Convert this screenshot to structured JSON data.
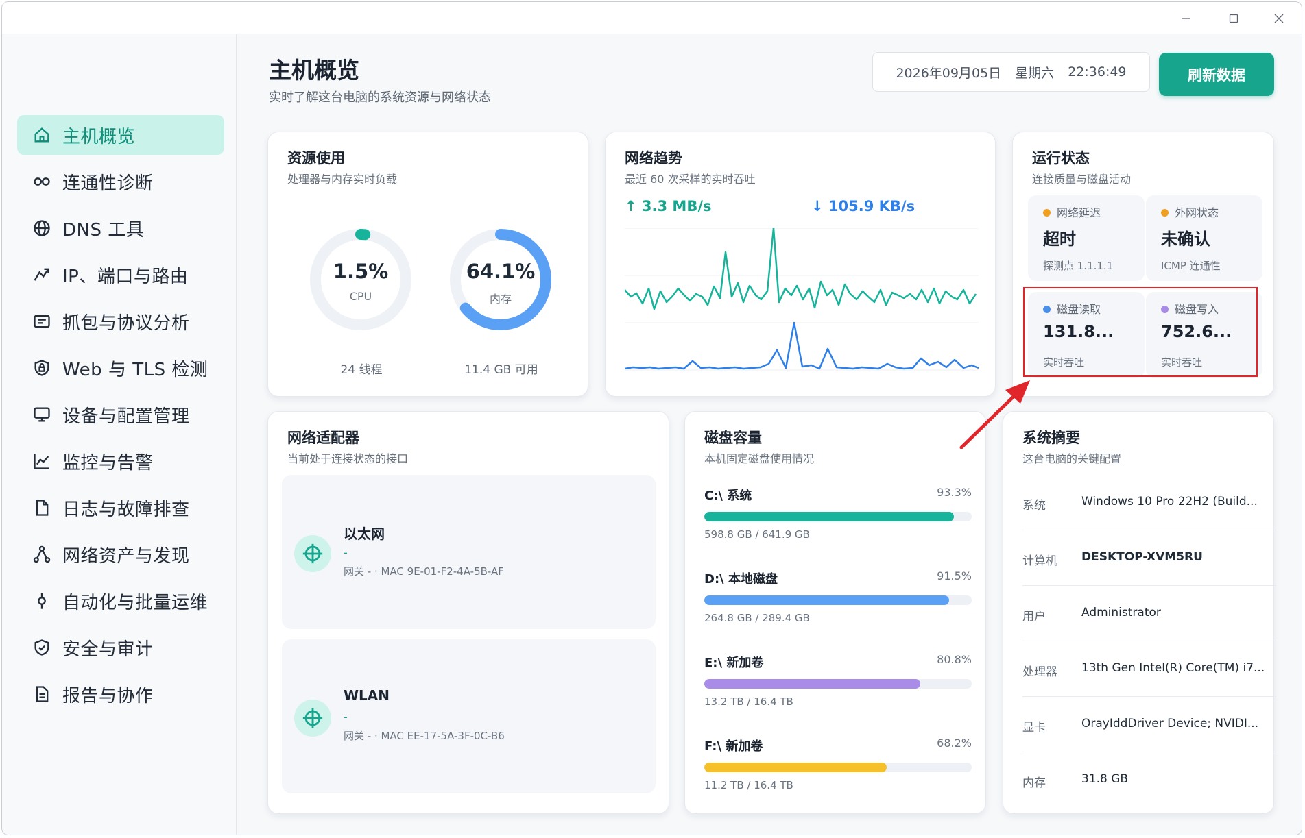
{
  "window": {
    "controls": {
      "minimize": "minimize-icon",
      "maximize": "maximize-icon",
      "close": "close-icon"
    }
  },
  "sidebar": {
    "items": [
      {
        "label": "主机概览",
        "icon": "home-icon",
        "active": true
      },
      {
        "label": "连通性诊断",
        "icon": "link-icon"
      },
      {
        "label": "DNS 工具",
        "icon": "globe-icon"
      },
      {
        "label": "IP、端口与路由",
        "icon": "route-icon"
      },
      {
        "label": "抓包与协议分析",
        "icon": "packet-icon"
      },
      {
        "label": "Web 与 TLS 检测",
        "icon": "shield-lock-icon"
      },
      {
        "label": "设备与配置管理",
        "icon": "monitor-icon"
      },
      {
        "label": "监控与告警",
        "icon": "chart-icon"
      },
      {
        "label": "日志与故障排查",
        "icon": "file-icon"
      },
      {
        "label": "网络资产与发现",
        "icon": "nodes-icon"
      },
      {
        "label": "自动化与批量运维",
        "icon": "automation-icon"
      },
      {
        "label": "安全与审计",
        "icon": "shield-check-icon"
      },
      {
        "label": "报告与协作",
        "icon": "report-icon"
      }
    ]
  },
  "header": {
    "title": "主机概览",
    "subtitle": "实时了解这台电脑的系统资源与网络状态",
    "date": "2026年09月05日",
    "weekday": "星期六",
    "time": "22:36:49",
    "refresh_label": "刷新数据"
  },
  "resource": {
    "title": "资源使用",
    "subtitle": "处理器与内存实时负载",
    "cpu": {
      "value": "1.5%",
      "label": "CPU",
      "foot": "24 线程",
      "fraction": 0.015,
      "color": "#17b39b"
    },
    "mem": {
      "value": "64.1%",
      "label": "内存",
      "foot": "11.4 GB 可用",
      "fraction": 0.641,
      "color": "#5aa0f5"
    }
  },
  "network_trend": {
    "title": "网络趋势",
    "subtitle": "最近 60 次采样的实时吞吐",
    "up": "↑ 3.3 MB/s",
    "down": "↓ 105.9 KB/s",
    "up_color": "#17b39b",
    "down_color": "#2f7fe8"
  },
  "status": {
    "title": "运行状态",
    "subtitle": "连接质量与磁盘活动",
    "tiles": [
      {
        "label": "网络延迟",
        "value": "超时",
        "foot": "探测点 1.1.1.1",
        "dot": "#f0a020"
      },
      {
        "label": "外网状态",
        "value": "未确认",
        "foot": "ICMP 连通性",
        "dot": "#f0a020"
      },
      {
        "label": "磁盘读取",
        "value": "131.8...",
        "foot": "实时吞吐",
        "dot": "#4a90e8"
      },
      {
        "label": "磁盘写入",
        "value": "752.6...",
        "foot": "实时吞吐",
        "dot": "#a98be8"
      }
    ]
  },
  "adapters": {
    "title": "网络适配器",
    "subtitle": "当前处于连接状态的接口",
    "items": [
      {
        "name": "以太网",
        "ip": "-",
        "meta": "网关 -  ·  MAC 9E-01-F2-4A-5B-AF"
      },
      {
        "name": "WLAN",
        "ip": "-",
        "meta": "网关 -  ·  MAC EE-17-5A-3F-0C-B6"
      }
    ]
  },
  "disks": {
    "title": "磁盘容量",
    "subtitle": "本机固定磁盘使用情况",
    "items": [
      {
        "name": "C:\\ 系统",
        "pct": "93.3%",
        "size": "598.8 GB / 641.9 GB",
        "fraction": 0.933,
        "color": "#17b39b"
      },
      {
        "name": "D:\\ 本地磁盘",
        "pct": "91.5%",
        "size": "264.8 GB / 289.4 GB",
        "fraction": 0.915,
        "color": "#5aa0f5"
      },
      {
        "name": "E:\\ 新加卷",
        "pct": "80.8%",
        "size": "13.2 TB / 16.4 TB",
        "fraction": 0.808,
        "color": "#a98be8"
      },
      {
        "name": "F:\\ 新加卷",
        "pct": "68.2%",
        "size": "11.2 TB / 16.4 TB",
        "fraction": 0.682,
        "color": "#f6c02b"
      }
    ]
  },
  "summary": {
    "title": "系统摘要",
    "subtitle": "这台电脑的关键配置",
    "rows": [
      {
        "key": "系统",
        "value": "Windows 10 Pro 22H2 (Build..."
      },
      {
        "key": "计算机",
        "value": "DESKTOP-XVM5RU"
      },
      {
        "key": "用户",
        "value": "Administrator"
      },
      {
        "key": "处理器",
        "value": "13th Gen Intel(R) Core(TM) i7..."
      },
      {
        "key": "显卡",
        "value": "OrayIddDriver Device; NVIDI..."
      },
      {
        "key": "内存",
        "value": "31.8 GB"
      }
    ]
  },
  "annotation": {
    "color": "#e0262a"
  }
}
